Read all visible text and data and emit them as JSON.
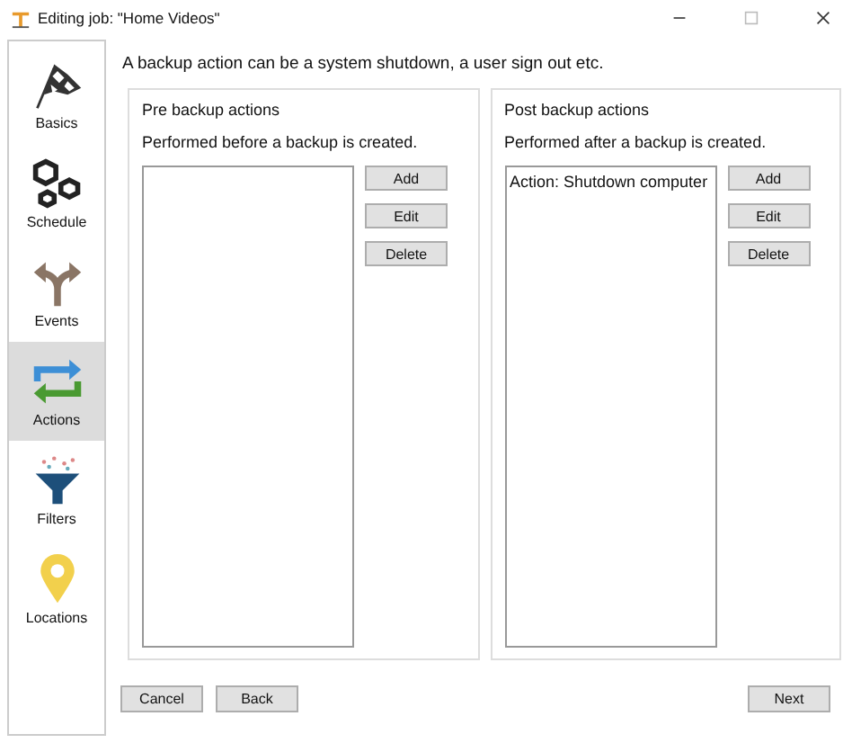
{
  "window": {
    "title": "Editing job: \"Home Videos\""
  },
  "sidebar": {
    "items": [
      {
        "label": "Basics",
        "kind": "flag",
        "selected": false
      },
      {
        "label": "Schedule",
        "kind": "nuts",
        "selected": false
      },
      {
        "label": "Events",
        "kind": "fork",
        "selected": false
      },
      {
        "label": "Actions",
        "kind": "cycle",
        "selected": true
      },
      {
        "label": "Filters",
        "kind": "funnel",
        "selected": false
      },
      {
        "label": "Locations",
        "kind": "pin",
        "selected": false
      }
    ]
  },
  "intro": "A backup action can be a system shutdown, a user sign out etc.",
  "panels": [
    {
      "title": "Pre backup actions",
      "subtitle": "Performed before a backup is created.",
      "buttons": [
        "Add",
        "Edit",
        "Delete"
      ]
    },
    {
      "title": "Post backup actions",
      "subtitle": "Performed after a backup is created.",
      "items": [
        "Action: Shutdown computer"
      ],
      "buttons": [
        "Add",
        "Edit",
        "Delete"
      ]
    }
  ],
  "footer": {
    "left_buttons": [
      "Cancel",
      "Back"
    ],
    "right_buttons": [
      "Next"
    ]
  }
}
